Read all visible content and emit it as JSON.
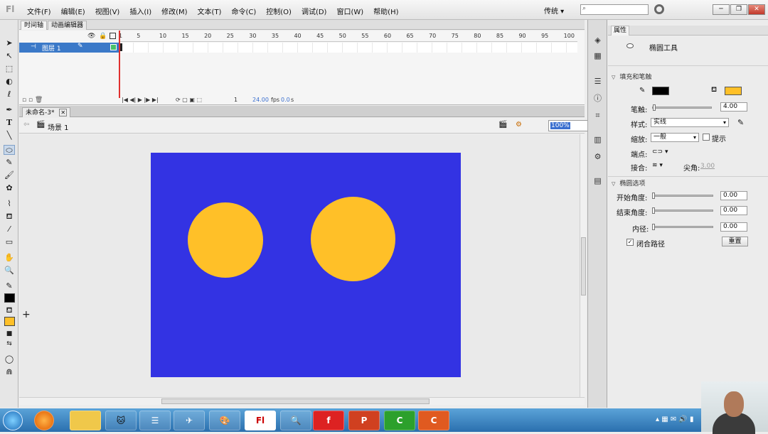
{
  "app": {
    "logo": "Fl",
    "menu": [
      "文件(F)",
      "编辑(E)",
      "视图(V)",
      "插入(I)",
      "修改(M)",
      "文本(T)",
      "命令(C)",
      "控制(O)",
      "调试(D)",
      "窗口(W)",
      "帮助(H)"
    ],
    "workspace": "传统 ▾"
  },
  "timeline": {
    "tabs": [
      "时间轴",
      "动画编辑器"
    ],
    "layer_name": "图层 1",
    "ruler": [
      "1",
      "5",
      "10",
      "15",
      "20",
      "25",
      "30",
      "35",
      "40",
      "45",
      "50",
      "55",
      "60",
      "65",
      "70",
      "75",
      "80",
      "85",
      "90",
      "95",
      "100"
    ],
    "current_frame": "1",
    "fps": "24.00",
    "fps_unit": "fps",
    "time": "0.0",
    "time_unit": "s"
  },
  "document": {
    "tab_title": "未命名-3*",
    "scene": "场景 1",
    "zoom": "100%"
  },
  "stage": {
    "background": "#3333e3",
    "fill_color": "#ffc028"
  },
  "properties": {
    "tab": "属性",
    "tool_name": "椭圆工具",
    "section_fill_stroke": "填充和笔触",
    "stroke_color": "#000000",
    "fill_color": "#ffc028",
    "stroke_label": "笔触:",
    "stroke_value": "4.00",
    "style_label": "样式:",
    "style_value": "实线",
    "scale_label": "缩放:",
    "scale_value": "一般",
    "hint_label": "提示",
    "cap_label": "端点:",
    "join_label": "接合:",
    "miter_label": "尖角:",
    "miter_value": "3.00",
    "section_ellipse": "椭圆选项",
    "start_angle_label": "开始角度:",
    "start_angle_value": "0.00",
    "end_angle_label": "结束角度:",
    "end_angle_value": "0.00",
    "inner_radius_label": "内径:",
    "inner_radius_value": "0.00",
    "close_path_label": "闭合路径",
    "reset_label": "重置"
  },
  "taskbar": {
    "apps": [
      "文件夹",
      "浏览器",
      "应用",
      "Fl",
      "画图",
      "Flash",
      "PowerPoint",
      "Camtasia",
      "Camtasia录制"
    ]
  }
}
